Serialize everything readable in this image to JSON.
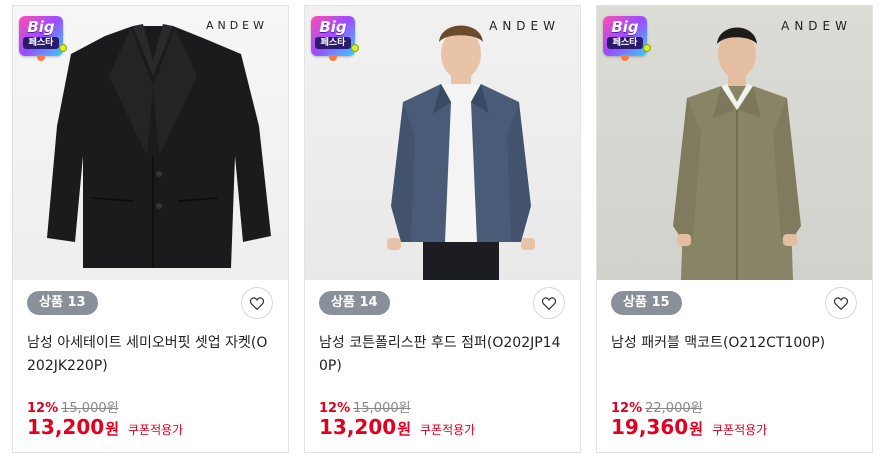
{
  "products": [
    {
      "brand": "ANDEW",
      "badge": "상품 13",
      "title": "남성 아세테이트 세미오버핏 셋업 자켓(O202JK220P)",
      "discount": "12%",
      "original_price": "15,000원",
      "final_price": "13,200",
      "currency": "원",
      "coupon_note": "쿠폰적용가",
      "image_icon": "black-jacket-image"
    },
    {
      "brand": "ANDEW",
      "badge": "상품 14",
      "title": "남성 코튼폴리스판 후드 점퍼(O202JP140P)",
      "discount": "12%",
      "original_price": "15,000원",
      "final_price": "13,200",
      "currency": "원",
      "coupon_note": "쿠폰적용가",
      "image_icon": "hooded-jumper-image"
    },
    {
      "brand": "ANDEW",
      "badge": "상품 15",
      "title": "남성 패커블 맥코트(O212CT100P)",
      "discount": "12%",
      "original_price": "22,000원",
      "final_price": "19,360",
      "currency": "원",
      "coupon_note": "쿠폰적용가",
      "image_icon": "mac-coat-image"
    }
  ],
  "festival_badge": {
    "big": "Big",
    "fest": "페스타"
  },
  "colors": {
    "accent_red": "#e1001f",
    "badge_gray": "#8a9099",
    "border": "#e3e3e3"
  }
}
